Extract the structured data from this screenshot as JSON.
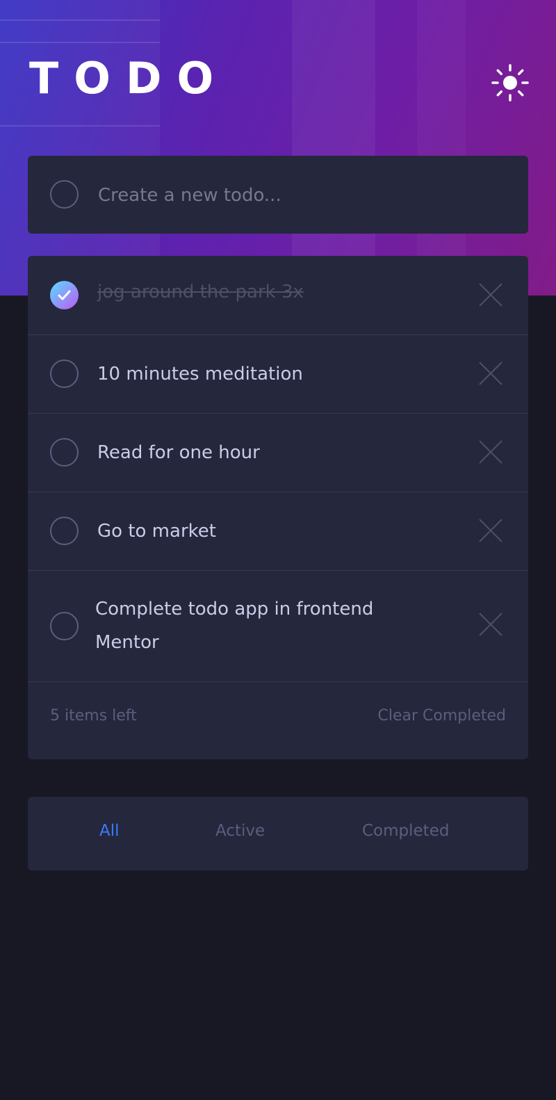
{
  "app": {
    "title": "TODO",
    "theme_icon": "sun-icon"
  },
  "new_todo": {
    "placeholder": "Create a new todo..."
  },
  "todos": [
    {
      "text": "jog around the park 3x",
      "completed": true
    },
    {
      "text": "10 minutes meditation",
      "completed": false
    },
    {
      "text": "Read for one hour",
      "completed": false
    },
    {
      "text": "Go to market",
      "completed": false
    },
    {
      "text": "Complete todo app in frontend Mentor",
      "completed": false
    }
  ],
  "footer": {
    "items_left": "5 items left",
    "clear_label": "Clear Completed"
  },
  "filters": {
    "all": "All",
    "active": "Active",
    "completed": "Completed",
    "selected": "All"
  },
  "colors": {
    "accent": "#3a7bfd",
    "check_gradient_start": "#57ddff",
    "check_gradient_end": "#c058f3",
    "card": "#25273c",
    "background": "#181824"
  }
}
